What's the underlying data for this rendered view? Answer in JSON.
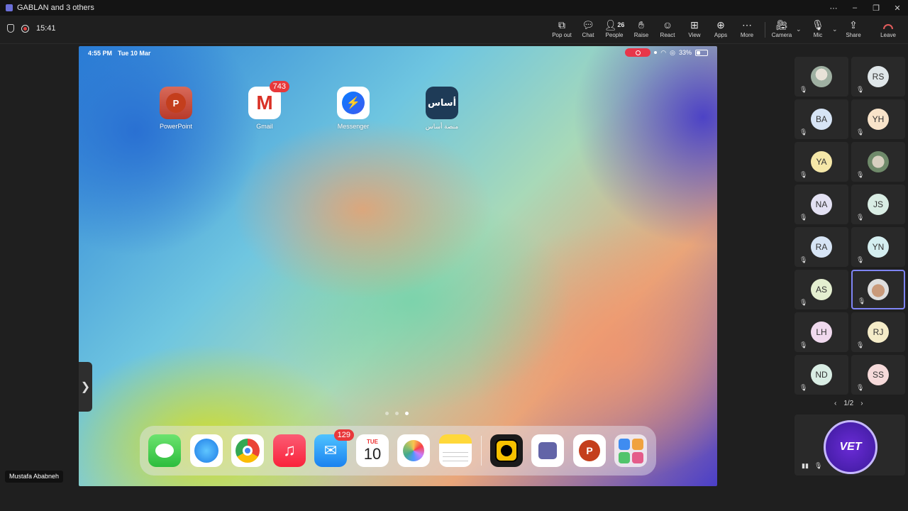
{
  "window": {
    "title": "GABLAN and 3 others",
    "controls": [
      "⋯",
      "–",
      "❐",
      "✕"
    ]
  },
  "meeting": {
    "timer": "15:41",
    "toolbar": {
      "popout": "Pop out",
      "chat": "Chat",
      "people": "People",
      "people_count": "26",
      "raise": "Raise",
      "react": "React",
      "view": "View",
      "apps": "Apps",
      "more": "More",
      "camera": "Camera",
      "mic": "Mic",
      "share": "Share",
      "leave": "Leave"
    },
    "leave_color": "#e05c5c"
  },
  "shared_screen": {
    "presenter": "Mustafa Ababneh",
    "status": {
      "time": "4:55 PM",
      "date": "Tue 10 Mar",
      "battery": "33%"
    },
    "home_apps": [
      {
        "name": "PowerPoint",
        "icon": "powerpoint-icon",
        "glyph": "P"
      },
      {
        "name": "Gmail",
        "icon": "gmail-icon",
        "glyph": "M",
        "badge": "743"
      },
      {
        "name": "Messenger",
        "icon": "messenger-icon",
        "glyph": "⚡"
      },
      {
        "name": "منصة أساس",
        "icon": "asas-icon",
        "glyph": "أساس"
      }
    ],
    "dock": {
      "mail_badge": "129",
      "calendar": {
        "dow": "TUE",
        "day": "10"
      },
      "music_glyph": "♫",
      "mail_glyph": "✉",
      "powerpoint_glyph": "P"
    }
  },
  "participants": [
    {
      "initials": "",
      "photo": "av-photo1",
      "bg": ""
    },
    {
      "initials": "RS",
      "bg": "#dfe6e9"
    },
    {
      "initials": "BA",
      "bg": "#d6e4f5"
    },
    {
      "initials": "YH",
      "bg": "#f8e3c9"
    },
    {
      "initials": "YA",
      "bg": "#f5e7a8"
    },
    {
      "initials": "",
      "photo": "av-photo2",
      "bg": ""
    },
    {
      "initials": "NA",
      "bg": "#e3e1f3"
    },
    {
      "initials": "JS",
      "bg": "#d9ede4"
    },
    {
      "initials": "RA",
      "bg": "#d6e4f5"
    },
    {
      "initials": "YN",
      "bg": "#d4eef0"
    },
    {
      "initials": "AS",
      "bg": "#e4efd0"
    },
    {
      "initials": "",
      "photo": "av-photo3",
      "bg": "",
      "active": true
    },
    {
      "initials": "LH",
      "bg": "#f0d9ee"
    },
    {
      "initials": "RJ",
      "bg": "#f5ecc8"
    },
    {
      "initials": "ND",
      "bg": "#d9ede4"
    },
    {
      "initials": "SS",
      "bg": "#f6dada"
    }
  ],
  "pager": {
    "label": "1/2",
    "prev": "‹",
    "next": "›"
  },
  "featured_logo": "VET"
}
